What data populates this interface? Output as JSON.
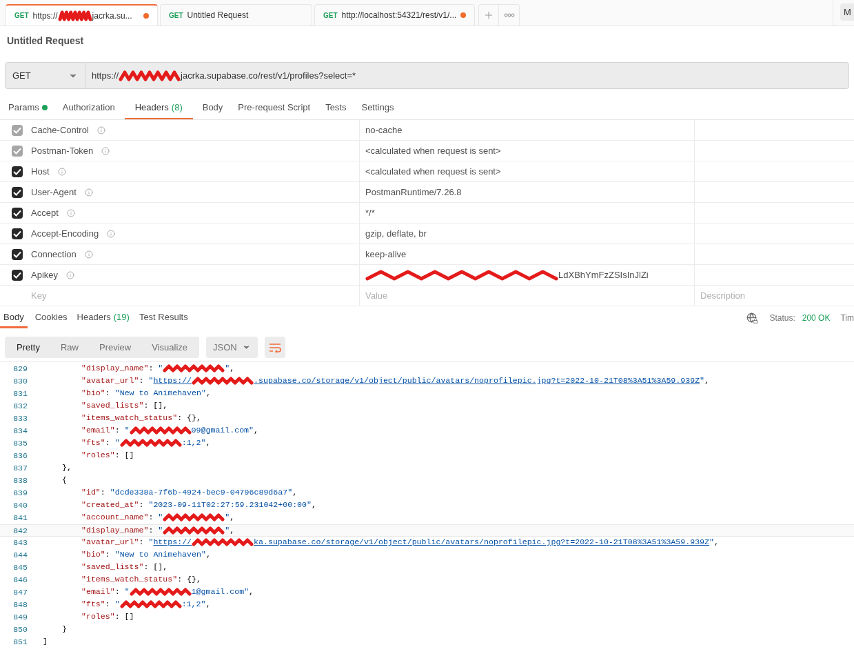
{
  "tabs": [
    {
      "method": "GET",
      "title": [
        {
          "kind": "text",
          "text": "https://"
        },
        {
          "kind": "redaction"
        },
        {
          "kind": "text",
          "text": "jacrka.su..."
        }
      ],
      "unsaved": true,
      "selected": true
    },
    {
      "method": "GET",
      "title": [
        {
          "kind": "text",
          "text": "Untitled Request"
        }
      ],
      "unsaved": false,
      "selected": false
    },
    {
      "method": "GET",
      "title": [
        {
          "kind": "text",
          "text": "http://localhost:54321/rest/v1/..."
        }
      ],
      "unsaved": true,
      "selected": false
    }
  ],
  "right_button": "M",
  "request_title": "Untitled Request",
  "method": "GET",
  "url": [
    {
      "kind": "text",
      "text": "https://"
    },
    {
      "kind": "redaction"
    },
    {
      "kind": "text",
      "text": "jacrka.supabase.co/rest/v1/profiles?select=*"
    }
  ],
  "request_tabs": [
    {
      "label": "Params",
      "dot": true,
      "selected": false
    },
    {
      "label": "Authorization",
      "dot": false,
      "selected": false
    },
    {
      "label": "Headers",
      "count": "(8)",
      "dot": false,
      "selected": true
    },
    {
      "label": "Body",
      "dot": false,
      "selected": false
    },
    {
      "label": "Pre-request Script",
      "dot": false,
      "selected": false
    },
    {
      "label": "Tests",
      "dot": false,
      "selected": false
    },
    {
      "label": "Settings",
      "dot": false,
      "selected": false
    }
  ],
  "headers": [
    {
      "key": "Cache-Control",
      "value": "no-cache",
      "redacted": false,
      "checked": true,
      "disabled": true
    },
    {
      "key": "Postman-Token",
      "value": "<calculated when request is sent>",
      "redacted": false,
      "checked": true,
      "disabled": true
    },
    {
      "key": "Host",
      "value": "<calculated when request is sent>",
      "redacted": false,
      "checked": true,
      "disabled": false
    },
    {
      "key": "User-Agent",
      "value": "PostmanRuntime/7.26.8",
      "redacted": false,
      "checked": true,
      "disabled": false
    },
    {
      "key": "Accept",
      "value": "*/*",
      "redacted": false,
      "checked": true,
      "disabled": false
    },
    {
      "key": "Accept-Encoding",
      "value": "gzip, deflate, br",
      "redacted": false,
      "checked": true,
      "disabled": false
    },
    {
      "key": "Connection",
      "value": "keep-alive",
      "redacted": false,
      "checked": true,
      "disabled": false
    },
    {
      "key": "Apikey",
      "value": "LdXBhYmFzZSIsInJlZi",
      "redacted": true,
      "checked": true,
      "disabled": false
    }
  ],
  "new_header": {
    "key_placeholder": "Key",
    "value_placeholder": "Value",
    "description_placeholder": "Description"
  },
  "response_tabs": [
    {
      "label": "Body",
      "selected": true
    },
    {
      "label": "Cookies",
      "selected": false
    },
    {
      "label": "Headers",
      "count": "(19)",
      "selected": false
    },
    {
      "label": "Test Results",
      "selected": false
    }
  ],
  "status_label": "Status:",
  "status_value": "200 OK",
  "time_label": "Tim",
  "view_modes": [
    {
      "label": "Pretty",
      "selected": true
    },
    {
      "label": "Raw",
      "selected": false
    },
    {
      "label": "Preview",
      "selected": false
    },
    {
      "label": "Visualize",
      "selected": false
    }
  ],
  "format": "JSON",
  "wrap_on": true,
  "code": [
    {
      "n": "829",
      "kind": "member",
      "selected": false,
      "tokens": [
        {
          "kind": "key",
          "text": "\"display_name\""
        },
        {
          "kind": "punct",
          "text": ": "
        },
        {
          "kind": "string",
          "text": "\""
        },
        {
          "kind": "redaction"
        },
        {
          "kind": "string",
          "text": "\""
        },
        {
          "kind": "punct",
          "text": ","
        }
      ]
    },
    {
      "n": "830",
      "kind": "member",
      "selected": false,
      "tokens": [
        {
          "kind": "key",
          "text": "\"avatar_url\""
        },
        {
          "kind": "punct",
          "text": ": "
        },
        {
          "kind": "string",
          "text": "\""
        },
        {
          "kind": "link",
          "text": "https://"
        },
        {
          "kind": "redaction"
        },
        {
          "kind": "link",
          "text": ".supabase.co/storage/v1/object/public/avatars/noprofilepic.jpg?t=2022-10-21T08%3A51%3A59.939Z"
        },
        {
          "kind": "string",
          "text": "\""
        },
        {
          "kind": "punct",
          "text": ","
        }
      ]
    },
    {
      "n": "831",
      "kind": "member",
      "selected": false,
      "tokens": [
        {
          "kind": "key",
          "text": "\"bio\""
        },
        {
          "kind": "punct",
          "text": ": "
        },
        {
          "kind": "string",
          "text": "\"New to Animehaven\""
        },
        {
          "kind": "punct",
          "text": ","
        }
      ]
    },
    {
      "n": "832",
      "kind": "member",
      "selected": false,
      "tokens": [
        {
          "kind": "key",
          "text": "\"saved_lists\""
        },
        {
          "kind": "punct",
          "text": ": [],"
        }
      ]
    },
    {
      "n": "833",
      "kind": "member",
      "selected": false,
      "tokens": [
        {
          "kind": "key",
          "text": "\"items_watch_status\""
        },
        {
          "kind": "punct",
          "text": ": {},"
        }
      ]
    },
    {
      "n": "834",
      "kind": "member",
      "selected": false,
      "tokens": [
        {
          "kind": "key",
          "text": "\"email\""
        },
        {
          "kind": "punct",
          "text": ": "
        },
        {
          "kind": "string",
          "text": "\""
        },
        {
          "kind": "redaction"
        },
        {
          "kind": "string",
          "text": "09@gmail.com\""
        },
        {
          "kind": "punct",
          "text": ","
        }
      ]
    },
    {
      "n": "835",
      "kind": "member",
      "selected": false,
      "tokens": [
        {
          "kind": "key",
          "text": "\"fts\""
        },
        {
          "kind": "punct",
          "text": ": "
        },
        {
          "kind": "string",
          "text": "\""
        },
        {
          "kind": "redaction"
        },
        {
          "kind": "string",
          "text": ":1,2\""
        },
        {
          "kind": "punct",
          "text": ","
        }
      ]
    },
    {
      "n": "836",
      "kind": "member",
      "selected": false,
      "tokens": [
        {
          "kind": "key",
          "text": "\"roles\""
        },
        {
          "kind": "punct",
          "text": ": []"
        }
      ]
    },
    {
      "n": "837",
      "kind": "brace",
      "selected": false,
      "tokens": [
        {
          "kind": "punct",
          "text": "},"
        }
      ]
    },
    {
      "n": "838",
      "kind": "brace",
      "selected": false,
      "tokens": [
        {
          "kind": "punct",
          "text": "{"
        }
      ]
    },
    {
      "n": "839",
      "kind": "member",
      "selected": false,
      "tokens": [
        {
          "kind": "key",
          "text": "\"id\""
        },
        {
          "kind": "punct",
          "text": ": "
        },
        {
          "kind": "string",
          "text": "\"dcde338a-7f6b-4924-bec9-04796c89d6a7\""
        },
        {
          "kind": "punct",
          "text": ","
        }
      ]
    },
    {
      "n": "840",
      "kind": "member",
      "selected": false,
      "tokens": [
        {
          "kind": "key",
          "text": "\"created_at\""
        },
        {
          "kind": "punct",
          "text": ": "
        },
        {
          "kind": "string",
          "text": "\"2023-09-11T02:27:59.231042+00:00\""
        },
        {
          "kind": "punct",
          "text": ","
        }
      ]
    },
    {
      "n": "841",
      "kind": "member",
      "selected": false,
      "tokens": [
        {
          "kind": "key",
          "text": "\"account_name\""
        },
        {
          "kind": "punct",
          "text": ": "
        },
        {
          "kind": "string",
          "text": "\""
        },
        {
          "kind": "redaction"
        },
        {
          "kind": "string",
          "text": "\""
        },
        {
          "kind": "punct",
          "text": ","
        }
      ]
    },
    {
      "n": "842",
      "kind": "member",
      "selected": true,
      "tokens": [
        {
          "kind": "key",
          "text": "\"display_name\""
        },
        {
          "kind": "punct",
          "text": ": "
        },
        {
          "kind": "string",
          "text": "\""
        },
        {
          "kind": "redaction"
        },
        {
          "kind": "string",
          "text": "\""
        },
        {
          "kind": "punct",
          "text": ","
        }
      ]
    },
    {
      "n": "843",
      "kind": "member",
      "selected": false,
      "tokens": [
        {
          "kind": "key",
          "text": "\"avatar_url\""
        },
        {
          "kind": "punct",
          "text": ": "
        },
        {
          "kind": "string",
          "text": "\""
        },
        {
          "kind": "link",
          "text": "https://"
        },
        {
          "kind": "redaction"
        },
        {
          "kind": "link",
          "text": "ka.supabase.co/storage/v1/object/public/avatars/noprofilepic.jpg?t=2022-10-21T08%3A51%3A59.939Z"
        },
        {
          "kind": "string",
          "text": "\""
        },
        {
          "kind": "punct",
          "text": ","
        }
      ]
    },
    {
      "n": "844",
      "kind": "member",
      "selected": false,
      "tokens": [
        {
          "kind": "key",
          "text": "\"bio\""
        },
        {
          "kind": "punct",
          "text": ": "
        },
        {
          "kind": "string",
          "text": "\"New to Animehaven\""
        },
        {
          "kind": "punct",
          "text": ","
        }
      ]
    },
    {
      "n": "845",
      "kind": "member",
      "selected": false,
      "tokens": [
        {
          "kind": "key",
          "text": "\"saved_lists\""
        },
        {
          "kind": "punct",
          "text": ": [],"
        }
      ]
    },
    {
      "n": "846",
      "kind": "member",
      "selected": false,
      "tokens": [
        {
          "kind": "key",
          "text": "\"items_watch_status\""
        },
        {
          "kind": "punct",
          "text": ": {},"
        }
      ]
    },
    {
      "n": "847",
      "kind": "member",
      "selected": false,
      "tokens": [
        {
          "kind": "key",
          "text": "\"email\""
        },
        {
          "kind": "punct",
          "text": ": "
        },
        {
          "kind": "string",
          "text": "\""
        },
        {
          "kind": "redaction"
        },
        {
          "kind": "string",
          "text": "1@gmail.com\""
        },
        {
          "kind": "punct",
          "text": ","
        }
      ]
    },
    {
      "n": "848",
      "kind": "member",
      "selected": false,
      "tokens": [
        {
          "kind": "key",
          "text": "\"fts\""
        },
        {
          "kind": "punct",
          "text": ": "
        },
        {
          "kind": "string",
          "text": "\""
        },
        {
          "kind": "redaction"
        },
        {
          "kind": "string",
          "text": ":1,2\""
        },
        {
          "kind": "punct",
          "text": ","
        }
      ]
    },
    {
      "n": "849",
      "kind": "member",
      "selected": false,
      "tokens": [
        {
          "kind": "key",
          "text": "\"roles\""
        },
        {
          "kind": "punct",
          "text": ": []"
        }
      ]
    },
    {
      "n": "850",
      "kind": "brace",
      "selected": false,
      "tokens": [
        {
          "kind": "punct",
          "text": "}"
        }
      ]
    },
    {
      "n": "851",
      "kind": "root",
      "selected": false,
      "tokens": [
        {
          "kind": "punct",
          "text": "]"
        }
      ]
    }
  ]
}
